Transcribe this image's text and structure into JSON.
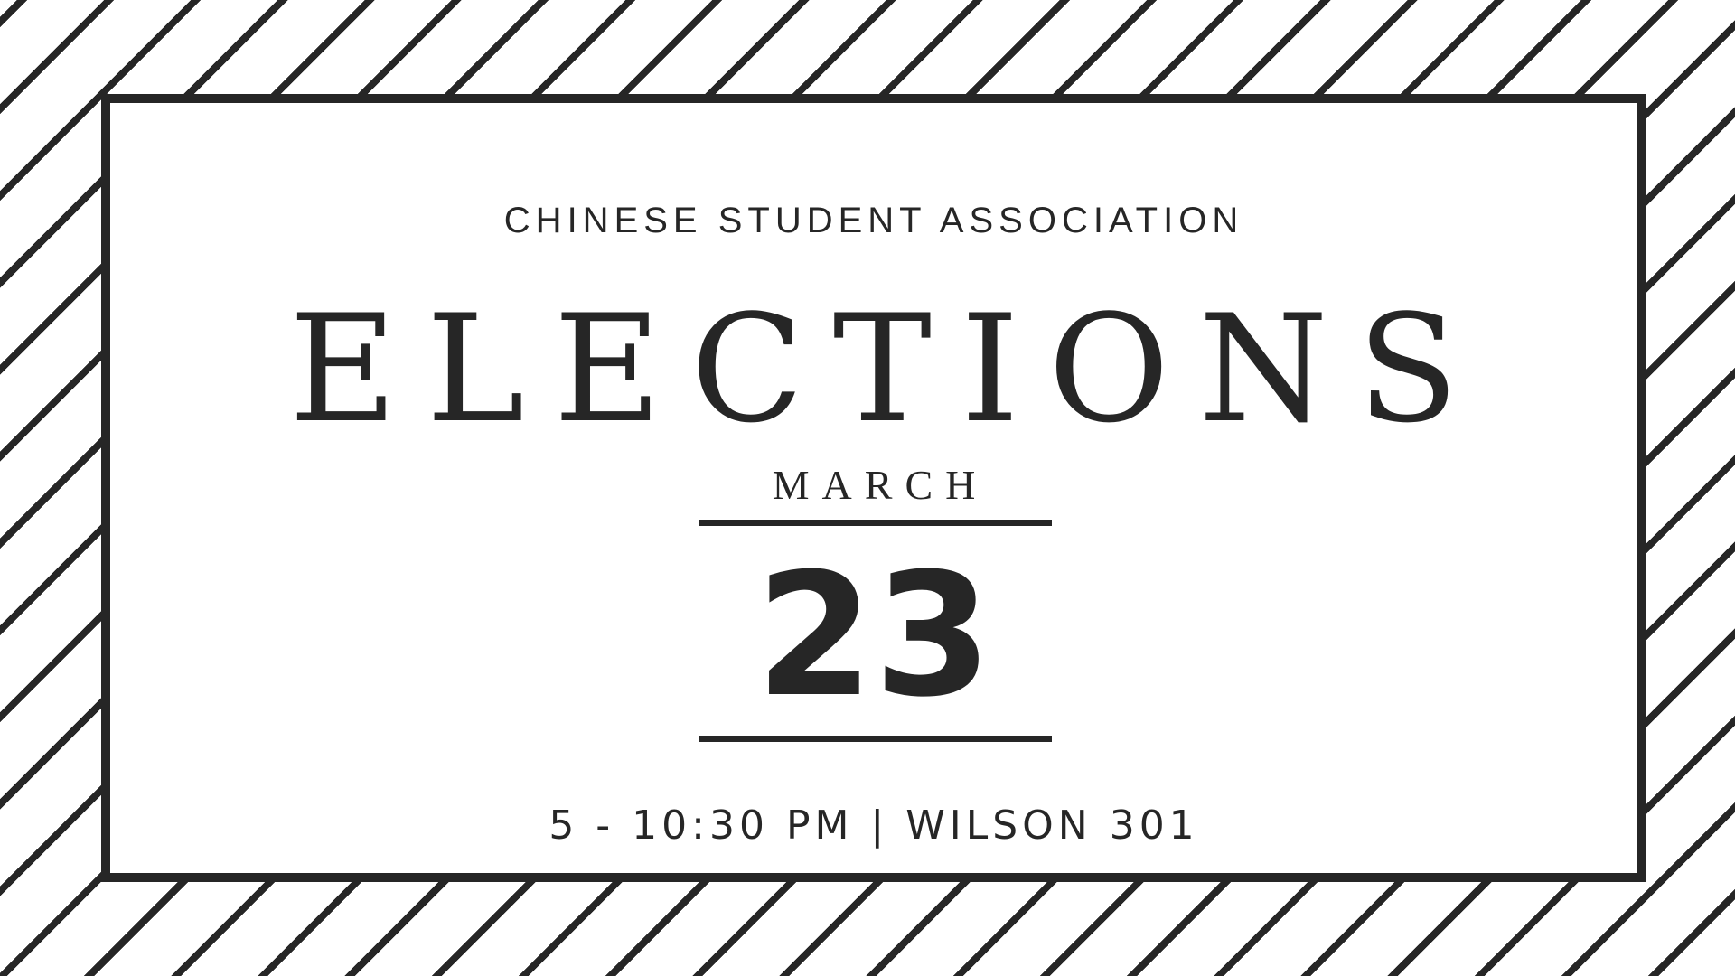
{
  "event": {
    "organization": "CHINESE STUDENT ASSOCIATION",
    "title": "ELECTIONS",
    "month": "MARCH",
    "day": "23",
    "details": "5 - 10:30 PM | WILSON 301"
  },
  "colors": {
    "ink": "#262626",
    "background": "#ffffff"
  },
  "decoration": {
    "background_pattern": "diagonal-stripes"
  }
}
